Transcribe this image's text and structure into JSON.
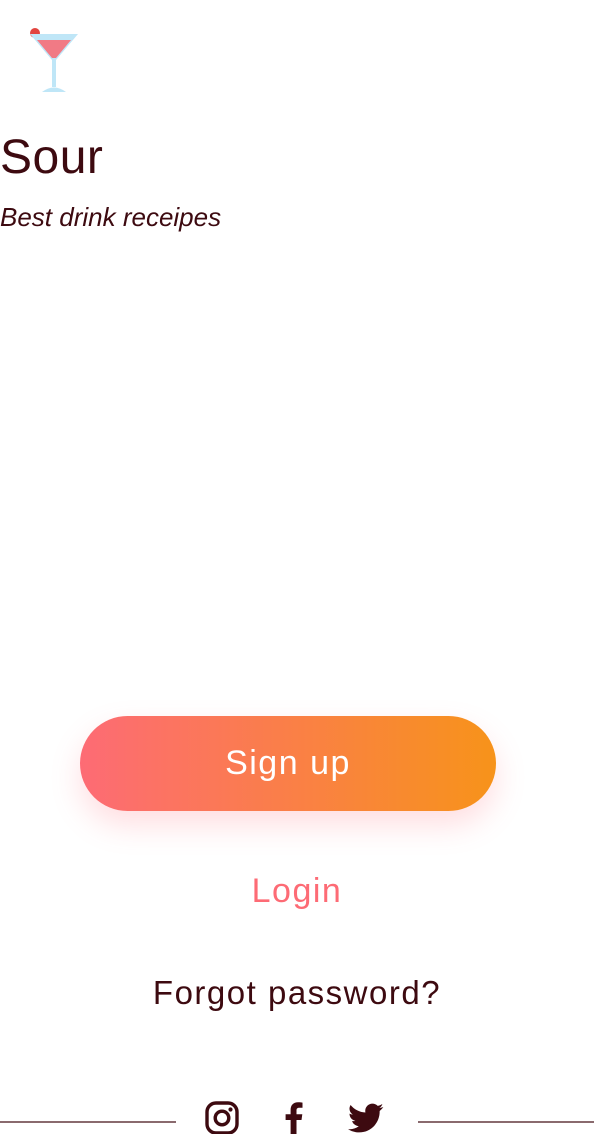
{
  "app": {
    "title": "Sour",
    "subtitle": "Best drink receipes",
    "logo_icon": "cocktail-glass-icon"
  },
  "actions": {
    "signup_label": "Sign up",
    "login_label": "Login",
    "forgot_label": "Forgot password?"
  },
  "social": {
    "icons": [
      "instagram-icon",
      "facebook-icon",
      "twitter-icon"
    ]
  },
  "colors": {
    "text_primary": "#3d0a10",
    "accent_pink": "#fd6b75",
    "accent_orange": "#f7931a"
  }
}
